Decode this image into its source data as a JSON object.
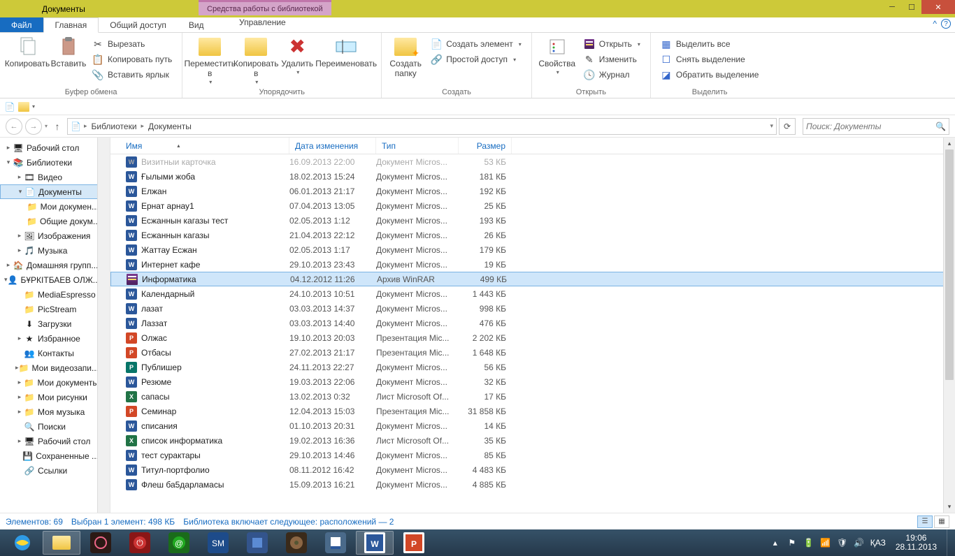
{
  "title": "Документы",
  "tools_context": "Средства работы с библиотекой",
  "ribbon_tabs": {
    "file": "Файл",
    "home": "Главная",
    "share": "Общий доступ",
    "view": "Вид",
    "manage": "Управление"
  },
  "ribbon": {
    "copy": "Копировать",
    "paste": "Вставить",
    "cut": "Вырезать",
    "copypath": "Копировать путь",
    "pastelink": "Вставить ярлык",
    "clipboard": "Буфер обмена",
    "moveto": "Переместить в",
    "copyto": "Копировать в",
    "delete": "Удалить",
    "rename": "Переименовать",
    "organize": "Упорядочить",
    "newfolder": "Создать папку",
    "newitem": "Создать элемент",
    "easyaccess": "Простой доступ",
    "create_grp": "Создать",
    "properties": "Свойства",
    "open": "Открыть",
    "edit": "Изменить",
    "history": "Журнал",
    "open_grp": "Открыть",
    "selectall": "Выделить все",
    "selectnone": "Снять выделение",
    "invert": "Обратить выделение",
    "select_grp": "Выделить"
  },
  "breadcrumb": [
    "Библиотеки",
    "Документы"
  ],
  "search_ph": "Поиск: Документы",
  "columns": {
    "name": "Имя",
    "date": "Дата изменения",
    "type": "Тип",
    "size": "Размер"
  },
  "tree": [
    {
      "lvl": 0,
      "ico": "desktop",
      "label": "Рабочий стол",
      "tw": "▸"
    },
    {
      "lvl": 0,
      "ico": "libs",
      "label": "Библиотеки",
      "tw": "▾"
    },
    {
      "lvl": 1,
      "ico": "video",
      "label": "Видео",
      "tw": "▸"
    },
    {
      "lvl": 1,
      "ico": "doc",
      "label": "Документы",
      "tw": "▾",
      "sel": true
    },
    {
      "lvl": 2,
      "ico": "folder",
      "label": "Мои докумен...",
      "tw": ""
    },
    {
      "lvl": 2,
      "ico": "folder",
      "label": "Общие докум...",
      "tw": ""
    },
    {
      "lvl": 1,
      "ico": "pic",
      "label": "Изображения",
      "tw": "▸"
    },
    {
      "lvl": 1,
      "ico": "music",
      "label": "Музыка",
      "tw": "▸"
    },
    {
      "lvl": 0,
      "ico": "home",
      "label": "Домашняя групп...",
      "tw": "▸"
    },
    {
      "lvl": 0,
      "ico": "user",
      "label": "БҰРКІТБАЕВ ОЛЖ...",
      "tw": "▾"
    },
    {
      "lvl": 1,
      "ico": "folder",
      "label": "MediaEspresso",
      "tw": ""
    },
    {
      "lvl": 1,
      "ico": "folder",
      "label": "PicStream",
      "tw": ""
    },
    {
      "lvl": 1,
      "ico": "dl",
      "label": "Загрузки",
      "tw": ""
    },
    {
      "lvl": 1,
      "ico": "fav",
      "label": "Избранное",
      "tw": "▸"
    },
    {
      "lvl": 1,
      "ico": "contacts",
      "label": "Контакты",
      "tw": ""
    },
    {
      "lvl": 1,
      "ico": "folder",
      "label": "Мои видеозапи...",
      "tw": "▸"
    },
    {
      "lvl": 1,
      "ico": "folder",
      "label": "Мои документы",
      "tw": "▸"
    },
    {
      "lvl": 1,
      "ico": "folder",
      "label": "Мои рисунки",
      "tw": "▸"
    },
    {
      "lvl": 1,
      "ico": "folder",
      "label": "Моя музыка",
      "tw": "▸"
    },
    {
      "lvl": 1,
      "ico": "search",
      "label": "Поиски",
      "tw": ""
    },
    {
      "lvl": 1,
      "ico": "desktop",
      "label": "Рабочий стол",
      "tw": "▸"
    },
    {
      "lvl": 1,
      "ico": "save",
      "label": "Сохраненные ...",
      "tw": ""
    },
    {
      "lvl": 1,
      "ico": "link",
      "label": "Ссылки",
      "tw": ""
    }
  ],
  "files": [
    {
      "ico": "word",
      "name": "Визитныи карточка",
      "date": "16.09.2013 22:00",
      "type": "Документ Micros...",
      "size": "53 КБ",
      "dim": true
    },
    {
      "ico": "word",
      "name": "Ғылыми жоба",
      "date": "18.02.2013 15:24",
      "type": "Документ Micros...",
      "size": "181 КБ"
    },
    {
      "ico": "word",
      "name": "Елжан",
      "date": "06.01.2013 21:17",
      "type": "Документ Micros...",
      "size": "192 КБ"
    },
    {
      "ico": "word",
      "name": "Ернат арнау1",
      "date": "07.04.2013 13:05",
      "type": "Документ Micros...",
      "size": "25 КБ"
    },
    {
      "ico": "word",
      "name": "Есжаннын кагазы тест",
      "date": "02.05.2013 1:12",
      "type": "Документ Micros...",
      "size": "193 КБ"
    },
    {
      "ico": "word",
      "name": "Есжаннын кагазы",
      "date": "21.04.2013 22:12",
      "type": "Документ Micros...",
      "size": "26 КБ"
    },
    {
      "ico": "word",
      "name": "Жаттау Есжан",
      "date": "02.05.2013 1:17",
      "type": "Документ Micros...",
      "size": "179 КБ"
    },
    {
      "ico": "word",
      "name": "Интернет кафе",
      "date": "29.10.2013 23:43",
      "type": "Документ Micros...",
      "size": "19 КБ"
    },
    {
      "ico": "rar",
      "name": "Информатика",
      "date": "04.12.2012 11:26",
      "type": "Архив WinRAR",
      "size": "499 КБ",
      "sel": true
    },
    {
      "ico": "word",
      "name": "Календарный",
      "date": "24.10.2013 10:51",
      "type": "Документ Micros...",
      "size": "1 443 КБ"
    },
    {
      "ico": "word",
      "name": "лазат",
      "date": "03.03.2013 14:37",
      "type": "Документ Micros...",
      "size": "998 КБ"
    },
    {
      "ico": "word",
      "name": "Лаззат",
      "date": "03.03.2013 14:40",
      "type": "Документ Micros...",
      "size": "476 КБ"
    },
    {
      "ico": "ppt",
      "name": "Олжас",
      "date": "19.10.2013 20:03",
      "type": "Презентация Mic...",
      "size": "2 202 КБ"
    },
    {
      "ico": "ppt",
      "name": "Отбасы",
      "date": "27.02.2013 21:17",
      "type": "Презентация Mic...",
      "size": "1 648 КБ"
    },
    {
      "ico": "pub",
      "name": "Публишер",
      "date": "24.11.2013 22:27",
      "type": "Документ Micros...",
      "size": "56 КБ"
    },
    {
      "ico": "word",
      "name": "Резюме",
      "date": "19.03.2013 22:06",
      "type": "Документ Micros...",
      "size": "32 КБ"
    },
    {
      "ico": "excel",
      "name": "сапасы",
      "date": "13.02.2013 0:32",
      "type": "Лист Microsoft Of...",
      "size": "17 КБ"
    },
    {
      "ico": "ppt",
      "name": "Семинар",
      "date": "12.04.2013 15:03",
      "type": "Презентация Mic...",
      "size": "31 858 КБ"
    },
    {
      "ico": "word",
      "name": "списания",
      "date": "01.10.2013 20:31",
      "type": "Документ Micros...",
      "size": "14 КБ"
    },
    {
      "ico": "excel",
      "name": "список информатика",
      "date": "19.02.2013 16:36",
      "type": "Лист Microsoft Of...",
      "size": "35 КБ"
    },
    {
      "ico": "word",
      "name": "тест сурактары",
      "date": "29.10.2013 14:46",
      "type": "Документ Micros...",
      "size": "85 КБ"
    },
    {
      "ico": "word",
      "name": "Титул-портфолио",
      "date": "08.11.2012 16:42",
      "type": "Документ Micros...",
      "size": "4 483 КБ"
    },
    {
      "ico": "word",
      "name": "Флеш ба5дарламасы",
      "date": "15.09.2013 16:21",
      "type": "Документ Micros...",
      "size": "4 885 КБ"
    }
  ],
  "status": {
    "items": "Элементов: 69",
    "selected": "Выбран 1 элемент: 498 КБ",
    "library": "Библиотека включает следующее: расположений — 2"
  },
  "tray": {
    "lang": "ҚАЗ",
    "time": "19:06",
    "date": "28.11.2013"
  }
}
